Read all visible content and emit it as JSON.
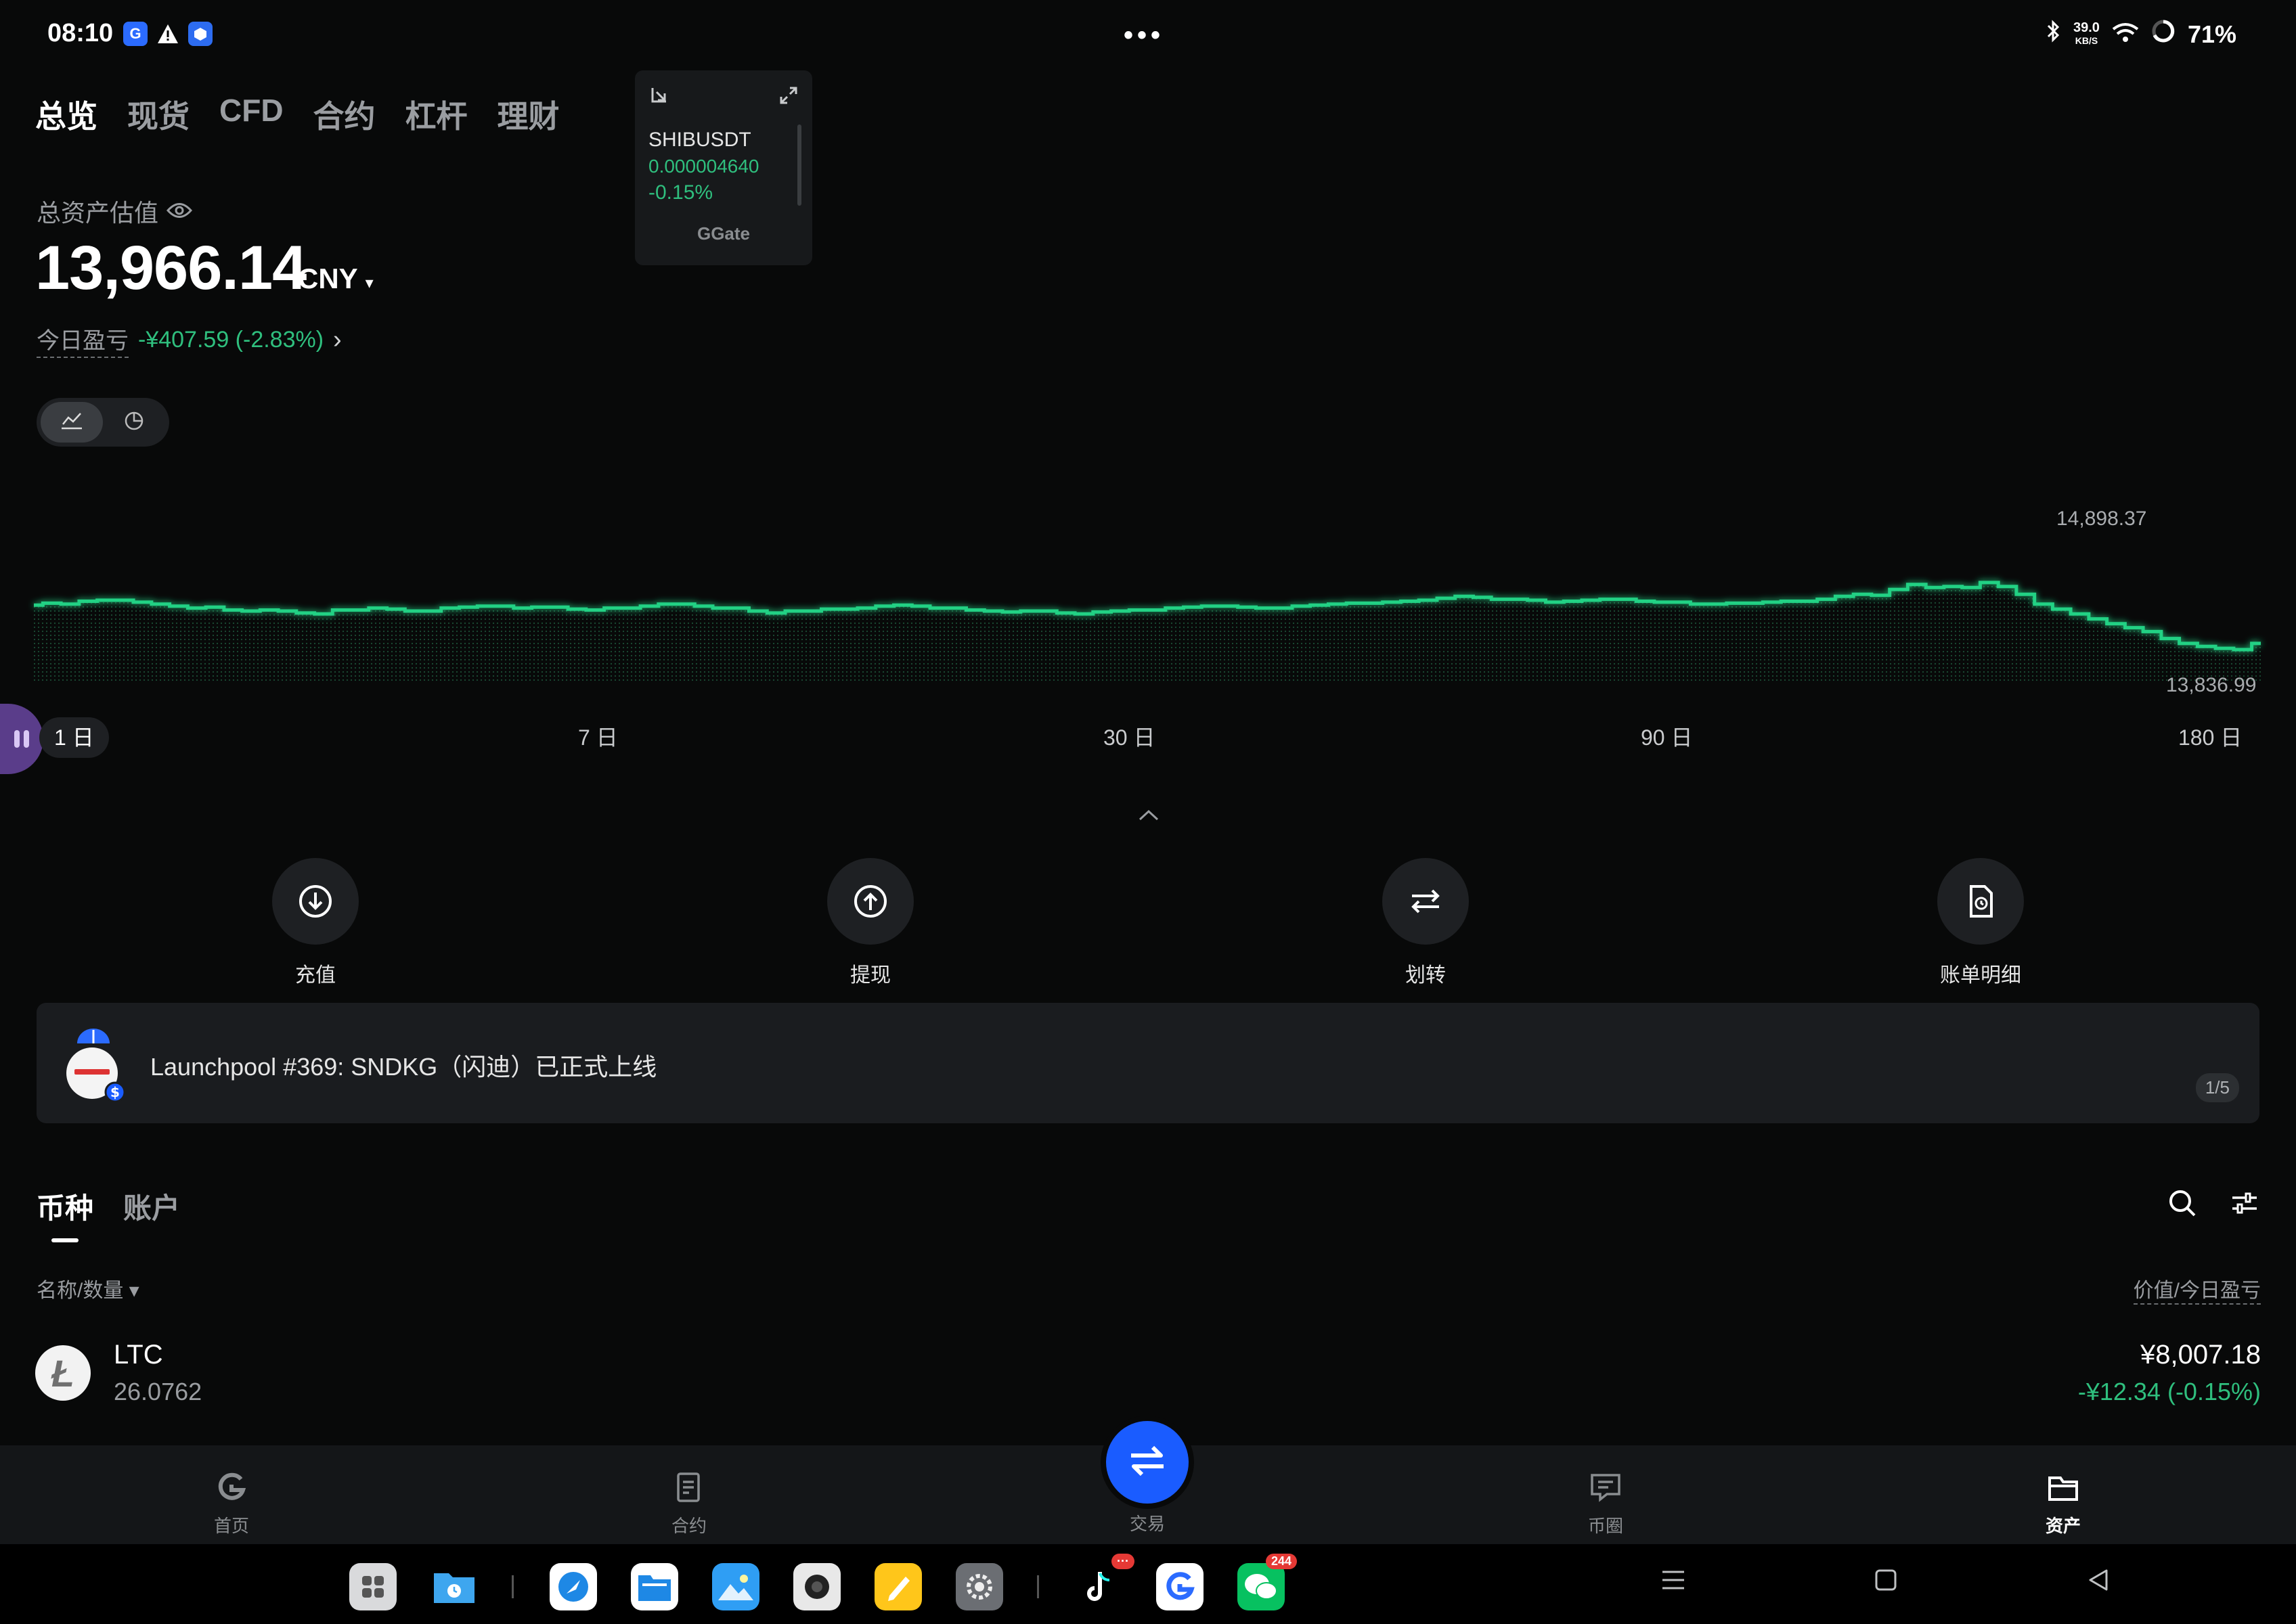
{
  "status_bar": {
    "time": "08:10",
    "network_speed_value": "39.0",
    "network_speed_unit": "KB/S",
    "battery": "71%"
  },
  "top_tabs": [
    {
      "label": "总览",
      "active": true
    },
    {
      "label": "现货",
      "active": false
    },
    {
      "label": "CFD",
      "active": false
    },
    {
      "label": "合约",
      "active": false
    },
    {
      "label": "杠杆",
      "active": false
    },
    {
      "label": "理财",
      "active": false
    }
  ],
  "widget": {
    "symbol": "SHIBUSDT",
    "price": "0.000004640",
    "change": "-0.15%",
    "brand": "Gate"
  },
  "assets": {
    "label": "总资产估值",
    "value": "13,966.14",
    "currency": "CNY",
    "pnl_label": "今日盈亏",
    "pnl_value": "-¥407.59 (-2.83%)"
  },
  "chart_data": {
    "type": "area",
    "max_label": "14,898.37",
    "min_label": "13,836.99",
    "max_value": 14898.37,
    "min_value": 13836.99,
    "values": [
      14290,
      14310,
      14300,
      14330,
      14340,
      14340,
      14320,
      14300,
      14280,
      14260,
      14270,
      14240,
      14230,
      14240,
      14230,
      14210,
      14200,
      14240,
      14240,
      14260,
      14250,
      14230,
      14230,
      14260,
      14270,
      14280,
      14280,
      14260,
      14270,
      14270,
      14250,
      14240,
      14260,
      14260,
      14280,
      14300,
      14300,
      14280,
      14260,
      14260,
      14230,
      14210,
      14230,
      14230,
      14250,
      14250,
      14260,
      14280,
      14290,
      14280,
      14260,
      14260,
      14240,
      14230,
      14220,
      14230,
      14230,
      14210,
      14200,
      14220,
      14230,
      14240,
      14240,
      14260,
      14270,
      14280,
      14280,
      14270,
      14260,
      14260,
      14280,
      14290,
      14300,
      14310,
      14310,
      14320,
      14330,
      14340,
      14360,
      14380,
      14370,
      14350,
      14350,
      14340,
      14320,
      14330,
      14340,
      14350,
      14350,
      14330,
      14320,
      14320,
      14300,
      14300,
      14310,
      14310,
      14320,
      14330,
      14330,
      14350,
      14380,
      14400,
      14390,
      14450,
      14500,
      14470,
      14480,
      14470,
      14520,
      14480,
      14400,
      14300,
      14250,
      14200,
      14150,
      14100,
      14060,
      14020,
      13950,
      13900,
      13870,
      13850,
      13836.99,
      13900
    ],
    "ranges": [
      "1 日",
      "7 日",
      "30 日",
      "90 日",
      "180 日"
    ],
    "active_range": "1 日",
    "grid": false,
    "line_color": "#20d184"
  },
  "actions": [
    {
      "label": "充值",
      "icon": "download-icon"
    },
    {
      "label": "提现",
      "icon": "upload-icon"
    },
    {
      "label": "划转",
      "icon": "transfer-icon"
    },
    {
      "label": "账单明细",
      "icon": "bill-icon"
    }
  ],
  "banner": {
    "text": "Launchpool #369: SNDKG（闪迪）已正式上线",
    "page": "1/5"
  },
  "coin_tabs": [
    {
      "label": "币种",
      "active": true
    },
    {
      "label": "账户",
      "active": false
    }
  ],
  "list_header": {
    "left": "名称/数量 ▾",
    "right": "价值/今日盈亏"
  },
  "coins": [
    {
      "symbol": "LTC",
      "quantity": "26.0762",
      "value": "¥8,007.18",
      "pnl": "-¥12.34 (-0.15%)"
    }
  ],
  "bottom_nav": [
    {
      "label": "首页",
      "active": false
    },
    {
      "label": "合约",
      "active": false
    },
    {
      "label": "交易",
      "active": false
    },
    {
      "label": "币圈",
      "active": false
    },
    {
      "label": "资产",
      "active": true
    }
  ],
  "dock": {
    "tiktok_badge": "···",
    "wechat_badge": "244"
  },
  "colors": {
    "background": "#080909",
    "positive": "#2fbf7e",
    "accent": "#1a5cff"
  }
}
